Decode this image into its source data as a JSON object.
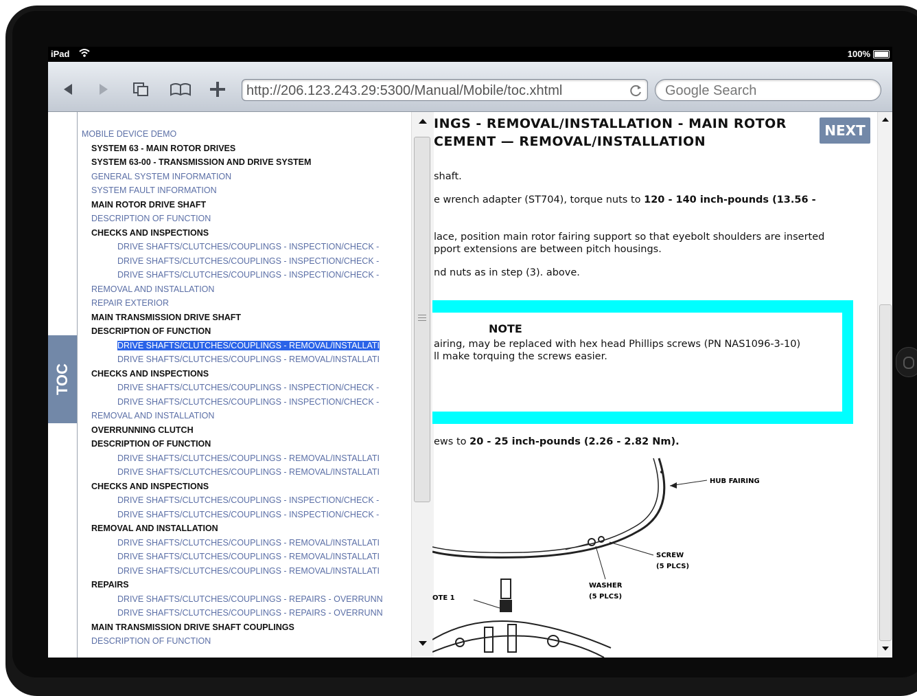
{
  "statusbar": {
    "device": "iPad",
    "battery": "100%"
  },
  "browser": {
    "url": "http://206.123.243.29:5300/Manual/Mobile/toc.xhtml",
    "search_placeholder": "Google Search"
  },
  "toc_tab": {
    "label": "TOC"
  },
  "toc": {
    "items": [
      {
        "text": "MOBILE DEVICE DEMO",
        "level": "root"
      },
      {
        "text": "SYSTEM 63 - MAIN ROTOR DRIVES",
        "level": "b"
      },
      {
        "text": "SYSTEM 63-00 - TRANSMISSION AND DRIVE SYSTEM",
        "level": "b"
      },
      {
        "text": "GENERAL SYSTEM INFORMATION",
        "level": "l"
      },
      {
        "text": "SYSTEM FAULT INFORMATION",
        "level": "l"
      },
      {
        "text": "MAIN ROTOR DRIVE SHAFT",
        "level": "b"
      },
      {
        "text": "DESCRIPTION OF FUNCTION",
        "level": "l"
      },
      {
        "text": "CHECKS AND INSPECTIONS",
        "level": "b"
      },
      {
        "text": "DRIVE SHAFTS/CLUTCHES/COUPLINGS - INSPECTION/CHECK -",
        "level": "s"
      },
      {
        "text": "DRIVE SHAFTS/CLUTCHES/COUPLINGS - INSPECTION/CHECK -",
        "level": "s"
      },
      {
        "text": "DRIVE SHAFTS/CLUTCHES/COUPLINGS - INSPECTION/CHECK -",
        "level": "s"
      },
      {
        "text": "REMOVAL AND INSTALLATION",
        "level": "l"
      },
      {
        "text": "REPAIR EXTERIOR",
        "level": "l"
      },
      {
        "text": "MAIN TRANSMISSION DRIVE SHAFT",
        "level": "b"
      },
      {
        "text": "DESCRIPTION OF FUNCTION",
        "level": "b"
      },
      {
        "text": "DRIVE SHAFTS/CLUTCHES/COUPLINGS - REMOVAL/INSTALLATI",
        "level": "s",
        "selected": true
      },
      {
        "text": "DRIVE SHAFTS/CLUTCHES/COUPLINGS - REMOVAL/INSTALLATI",
        "level": "s"
      },
      {
        "text": "CHECKS AND INSPECTIONS",
        "level": "b"
      },
      {
        "text": "DRIVE SHAFTS/CLUTCHES/COUPLINGS - INSPECTION/CHECK -",
        "level": "s"
      },
      {
        "text": "DRIVE SHAFTS/CLUTCHES/COUPLINGS - INSPECTION/CHECK -",
        "level": "s"
      },
      {
        "text": "REMOVAL AND INSTALLATION",
        "level": "l"
      },
      {
        "text": "OVERRUNNING CLUTCH",
        "level": "b"
      },
      {
        "text": "DESCRIPTION OF FUNCTION",
        "level": "b"
      },
      {
        "text": "DRIVE SHAFTS/CLUTCHES/COUPLINGS - REMOVAL/INSTALLATI",
        "level": "s"
      },
      {
        "text": "DRIVE SHAFTS/CLUTCHES/COUPLINGS - REMOVAL/INSTALLATI",
        "level": "s"
      },
      {
        "text": "CHECKS AND INSPECTIONS",
        "level": "b"
      },
      {
        "text": "DRIVE SHAFTS/CLUTCHES/COUPLINGS - INSPECTION/CHECK -",
        "level": "s"
      },
      {
        "text": "DRIVE SHAFTS/CLUTCHES/COUPLINGS - INSPECTION/CHECK -",
        "level": "s"
      },
      {
        "text": "REMOVAL AND INSTALLATION",
        "level": "b"
      },
      {
        "text": "DRIVE SHAFTS/CLUTCHES/COUPLINGS - REMOVAL/INSTALLATI",
        "level": "s"
      },
      {
        "text": "DRIVE SHAFTS/CLUTCHES/COUPLINGS - REMOVAL/INSTALLATI",
        "level": "s"
      },
      {
        "text": "DRIVE SHAFTS/CLUTCHES/COUPLINGS - REMOVAL/INSTALLATI",
        "level": "s"
      },
      {
        "text": "REPAIRS",
        "level": "b"
      },
      {
        "text": "DRIVE SHAFTS/CLUTCHES/COUPLINGS - REPAIRS - OVERRUNN",
        "level": "s"
      },
      {
        "text": "DRIVE SHAFTS/CLUTCHES/COUPLINGS - REPAIRS - OVERRUNN",
        "level": "s"
      },
      {
        "text": "MAIN TRANSMISSION DRIVE SHAFT COUPLINGS",
        "level": "b"
      },
      {
        "text": "DESCRIPTION OF FUNCTION",
        "level": "l"
      }
    ]
  },
  "content": {
    "title_line1": "INGS - REMOVAL/INSTALLATION - MAIN ROTOR",
    "title_line2": "CEMENT — REMOVAL/INSTALLATION",
    "next_label": "NEXT",
    "p1": "shaft.",
    "p2a": "e wrench adapter (ST704), torque nuts to ",
    "p2b": "120 - 140 inch-pounds (13.56 -",
    "p3a": "lace, position main rotor fairing support so that eyebolt shoulders are inserted",
    "p3b": "pport extensions are between pitch housings.",
    "p4": "nd nuts as in step (3). above.",
    "note_title": "NOTE",
    "note_line1": "airing, may be replaced with hex head Phillips screws (PN NAS1096-3-10)",
    "note_line2": "ll make torquing the screws easier.",
    "p5a": "ews to ",
    "p5b": "20 - 25 inch-pounds (2.26 - 2.82 Nm).",
    "diagram_labels": {
      "hub_fairing": "HUB FAIRING",
      "screw": "SCREW",
      "screw_qty": "(5 PLCS)",
      "washer": "WASHER",
      "washer_qty": "(5 PLCS)",
      "note_ref": "OTE 1"
    }
  },
  "colors": {
    "toc_tab": "#7288a8",
    "note_border": "#00ffff",
    "link": "#5b6fa6",
    "selection": "#2a63e8"
  }
}
